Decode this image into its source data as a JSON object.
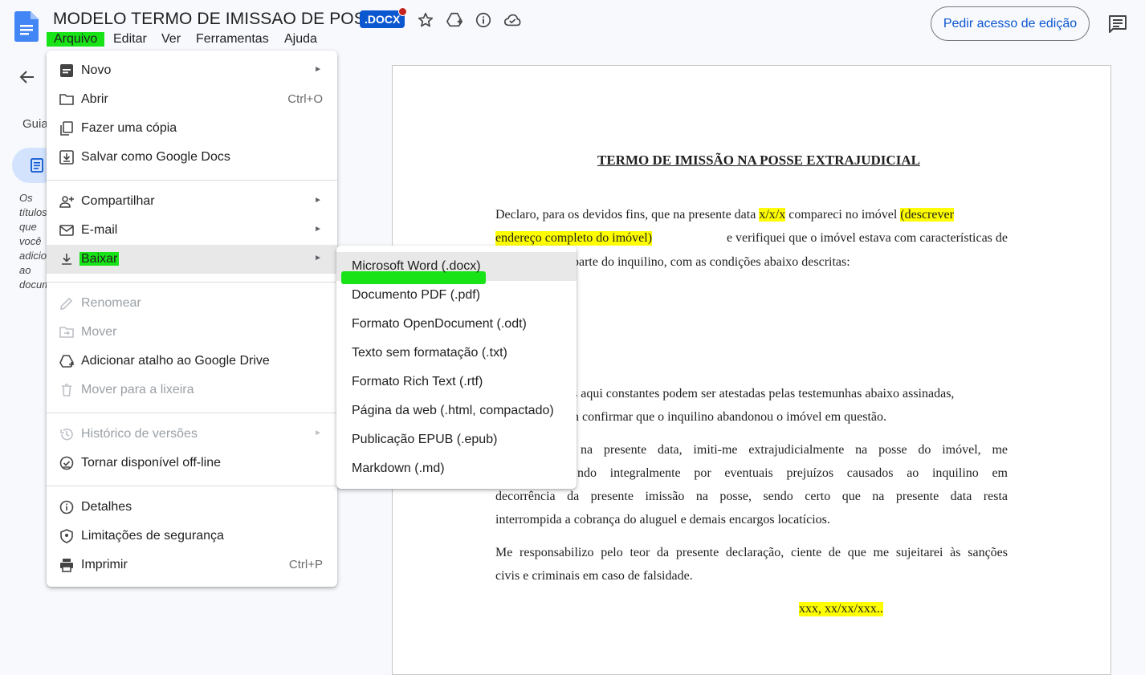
{
  "app": {
    "title": "MODELO TERMO DE IMISSAO DE POSSE",
    "badge": ".DOCX",
    "share_button": "Pedir acesso de edição"
  },
  "menubar": [
    "Arquivo",
    "Editar",
    "Ver",
    "Ferramentas",
    "Ajuda"
  ],
  "sidebar": {
    "label": "Guia",
    "text": "Os títulos que você adicionar ao documento"
  },
  "file_menu": {
    "items": [
      {
        "label": "Novo",
        "icon": "new-doc-icon",
        "arrow": "►"
      },
      {
        "label": "Abrir",
        "icon": "folder-icon",
        "shortcut": "Ctrl+O"
      },
      {
        "label": "Fazer uma cópia",
        "icon": "copy-icon"
      },
      {
        "label": "Salvar como Google Docs",
        "icon": "save-icon"
      },
      {
        "label": "Compartilhar",
        "icon": "person-add-icon",
        "arrow": "►"
      },
      {
        "label": "E-mail",
        "icon": "mail-icon",
        "arrow": "►"
      },
      {
        "label": "Baixar",
        "icon": "download-icon",
        "arrow": "►"
      },
      {
        "label": "Renomear",
        "icon": "pencil-icon"
      },
      {
        "label": "Mover",
        "icon": "move-folder-icon"
      },
      {
        "label": "Adicionar atalho ao Google Drive",
        "icon": "drive-shortcut-icon"
      },
      {
        "label": "Mover para a lixeira",
        "icon": "trash-icon"
      },
      {
        "label": "Histórico de versões",
        "icon": "history-icon",
        "arrow": "►"
      },
      {
        "label": "Tornar disponível off-line",
        "icon": "offline-icon"
      },
      {
        "label": "Detalhes",
        "icon": "info-icon"
      },
      {
        "label": "Limitações de segurança",
        "icon": "shield-icon"
      },
      {
        "label": "Imprimir",
        "icon": "print-icon",
        "shortcut": "Ctrl+P"
      }
    ]
  },
  "download_submenu": {
    "items": [
      "Microsoft Word (.docx)",
      "Documento PDF (.pdf)",
      "Formato OpenDocument (.odt)",
      "Texto sem formatação (.txt)",
      "Formato Rich Text (.rtf)",
      "Página da web (.html, compactado)",
      "Publicação EPUB (.epub)",
      "Markdown (.md)"
    ]
  },
  "document": {
    "title": "TERMO DE IMISSÃO NA POSSE EXTRAJUDICIAL",
    "p1_l1_a": "Declaro, para os devidos fins, que na presente data",
    "p1_l1_hl1": "x/x/x",
    "p1_l1_b": "compareci no imóvel",
    "p1_l1_hl2": "(descrever",
    "p1_l2_hl": "endereço completo do imóvel)",
    "p1_l2_b": "e verifiquei que o imóvel estava com características de",
    "p1_l3": "parte do inquilino, com as condições abaixo descritas:",
    "p2_l1": "s aqui constantes podem ser atestadas pelas testemunhas abaixo assinadas,",
    "p2_l2": "n confirmar que o inquilino abandonou o imóvel em questão.",
    "p3_l1": "na presente data, imiti-me extrajudicialmente na posse do imóvel, me",
    "p3_l2": "ndo integralmente por eventuais prejuízos causados ao inquilino em",
    "p3_l3": "decorrência da presente imissão na posse, sendo certo que na presente data resta",
    "p3_l4": "interrompida a cobrança do aluguel e demais encargos locatícios.",
    "p4_l1": "Me responsabilizo pelo teor da presente declaração, ciente de que me sujeitarei às sanções",
    "p4_l2": "civis e criminais em caso de falsidade.",
    "footer": "xxx, xx/xx/xxx.."
  }
}
